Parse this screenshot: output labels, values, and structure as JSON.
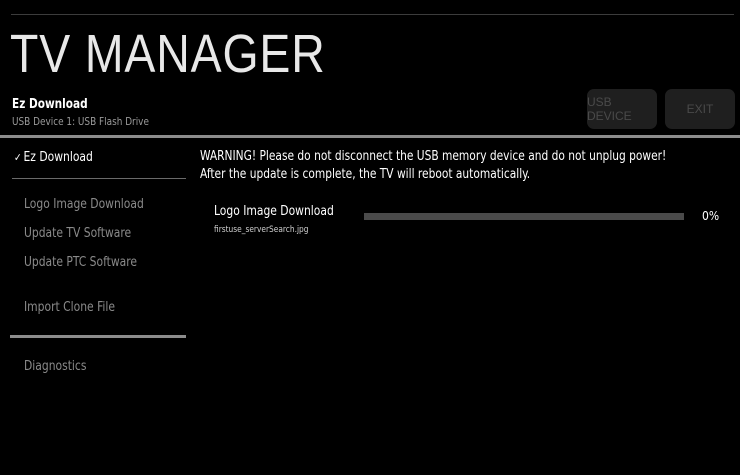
{
  "header": {
    "title": "TV MANAGER",
    "section": "Ez Download",
    "device": "USB Device 1: USB Flash Drive",
    "buttons": {
      "usb_device": "USB DEVICE",
      "exit": "EXIT"
    }
  },
  "menu": {
    "active": {
      "check": "✓",
      "label": "Ez Download"
    },
    "items": [
      "Logo Image Download",
      "Update TV Software",
      "Update PTC Software",
      "Import Clone File",
      "Diagnostics"
    ]
  },
  "main": {
    "warning_line1": "WARNING! Please do not disconnect the USB memory device and do not unplug power!",
    "warning_line2": "After the update is complete, the TV will reboot automatically.",
    "download": {
      "name": "Logo Image Download",
      "file": "firstuse_serverSearch.jpg",
      "progress_fraction": 0,
      "progress_label": "0%"
    }
  },
  "colors": {
    "background": "#000000",
    "text": "#ffffff",
    "dim_text": "#8a8a8a",
    "button": "#1f1f1f"
  }
}
